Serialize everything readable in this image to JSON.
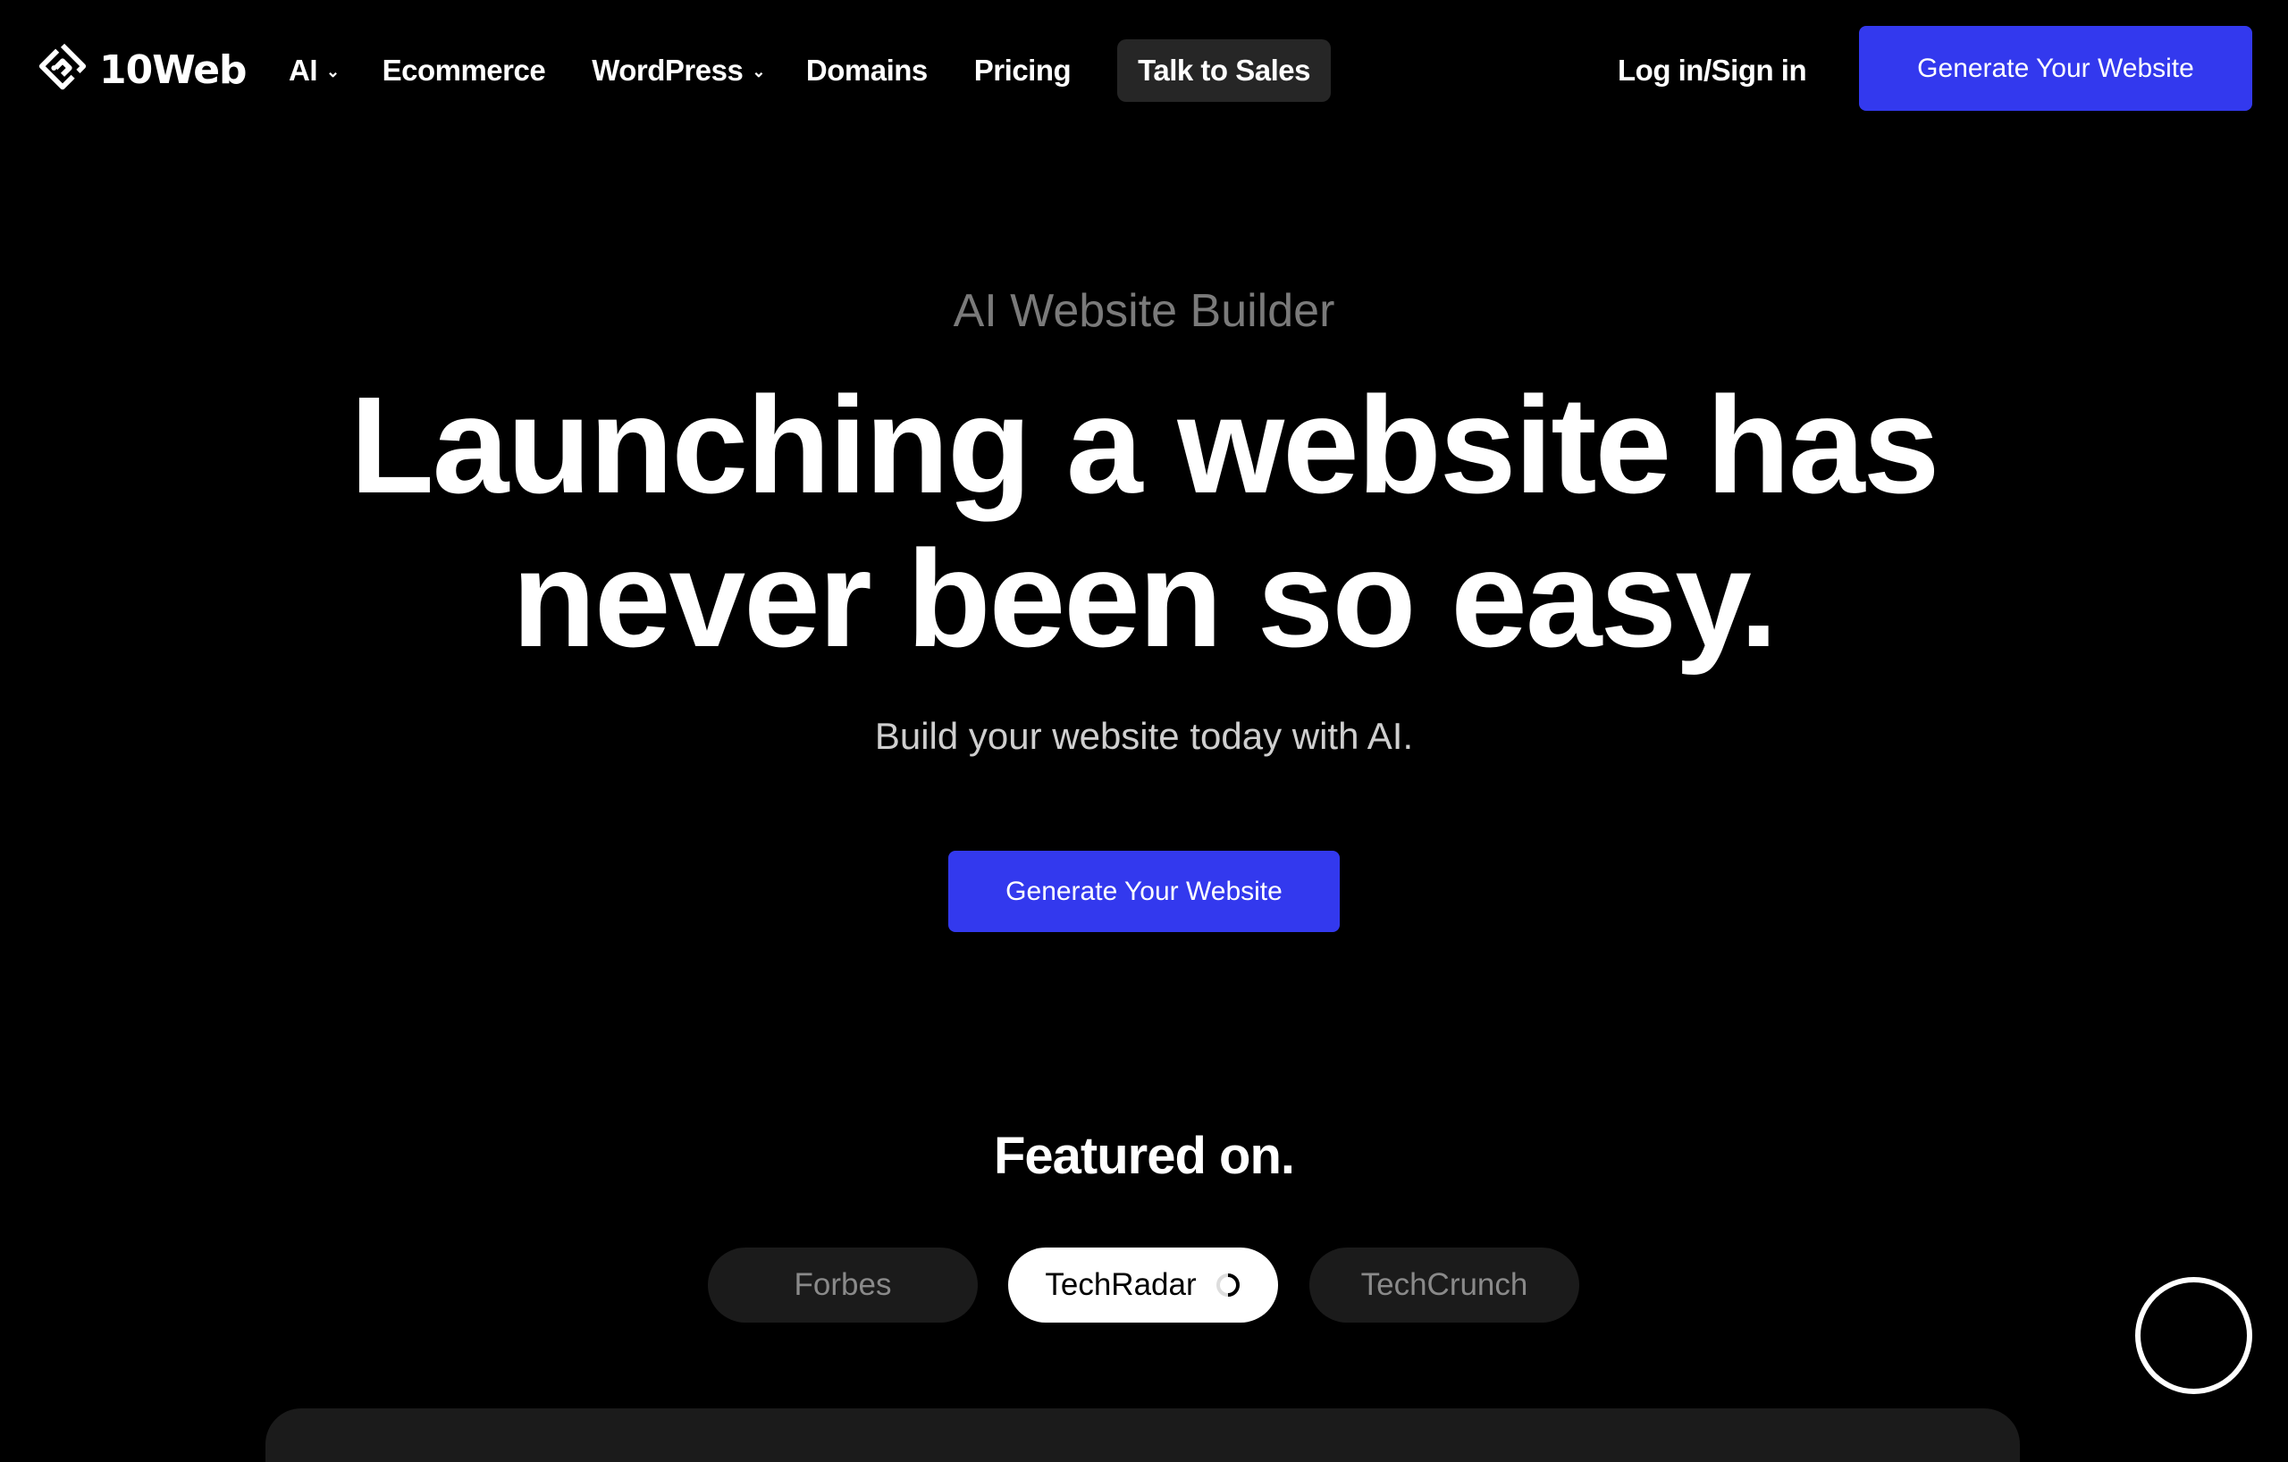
{
  "brand": {
    "name": "10Web",
    "logo_icon": "10web-diamond-logo-icon"
  },
  "nav": {
    "items": [
      {
        "label": "AI",
        "has_dropdown": true
      },
      {
        "label": "Ecommerce",
        "has_dropdown": false
      },
      {
        "label": "WordPress",
        "has_dropdown": true
      },
      {
        "label": "Domains",
        "has_dropdown": false
      },
      {
        "label": "Pricing",
        "has_dropdown": false
      }
    ],
    "talk_to_sales": "Talk to Sales",
    "login": "Log in/Sign in",
    "cta": "Generate Your Website",
    "dropdown_icon": "chevron-down-icon"
  },
  "hero": {
    "eyebrow": "AI Website Builder",
    "headline_line1": "Launching a website has",
    "headline_line2": "never been so easy.",
    "subtitle": "Build your website today with AI.",
    "cta": "Generate Your Website"
  },
  "featured": {
    "title": "Featured on.",
    "pills": [
      {
        "label": "Forbes",
        "active": false
      },
      {
        "label": "TechRadar",
        "active": true,
        "icon": "loading-spinner-icon"
      },
      {
        "label": "TechCrunch",
        "active": false
      }
    ]
  },
  "colors": {
    "background": "#000000",
    "accent": "#3339EE",
    "talk_bg": "#262626",
    "pill_bg": "#1B1B1B",
    "eyebrow": "#7A7A7A"
  }
}
